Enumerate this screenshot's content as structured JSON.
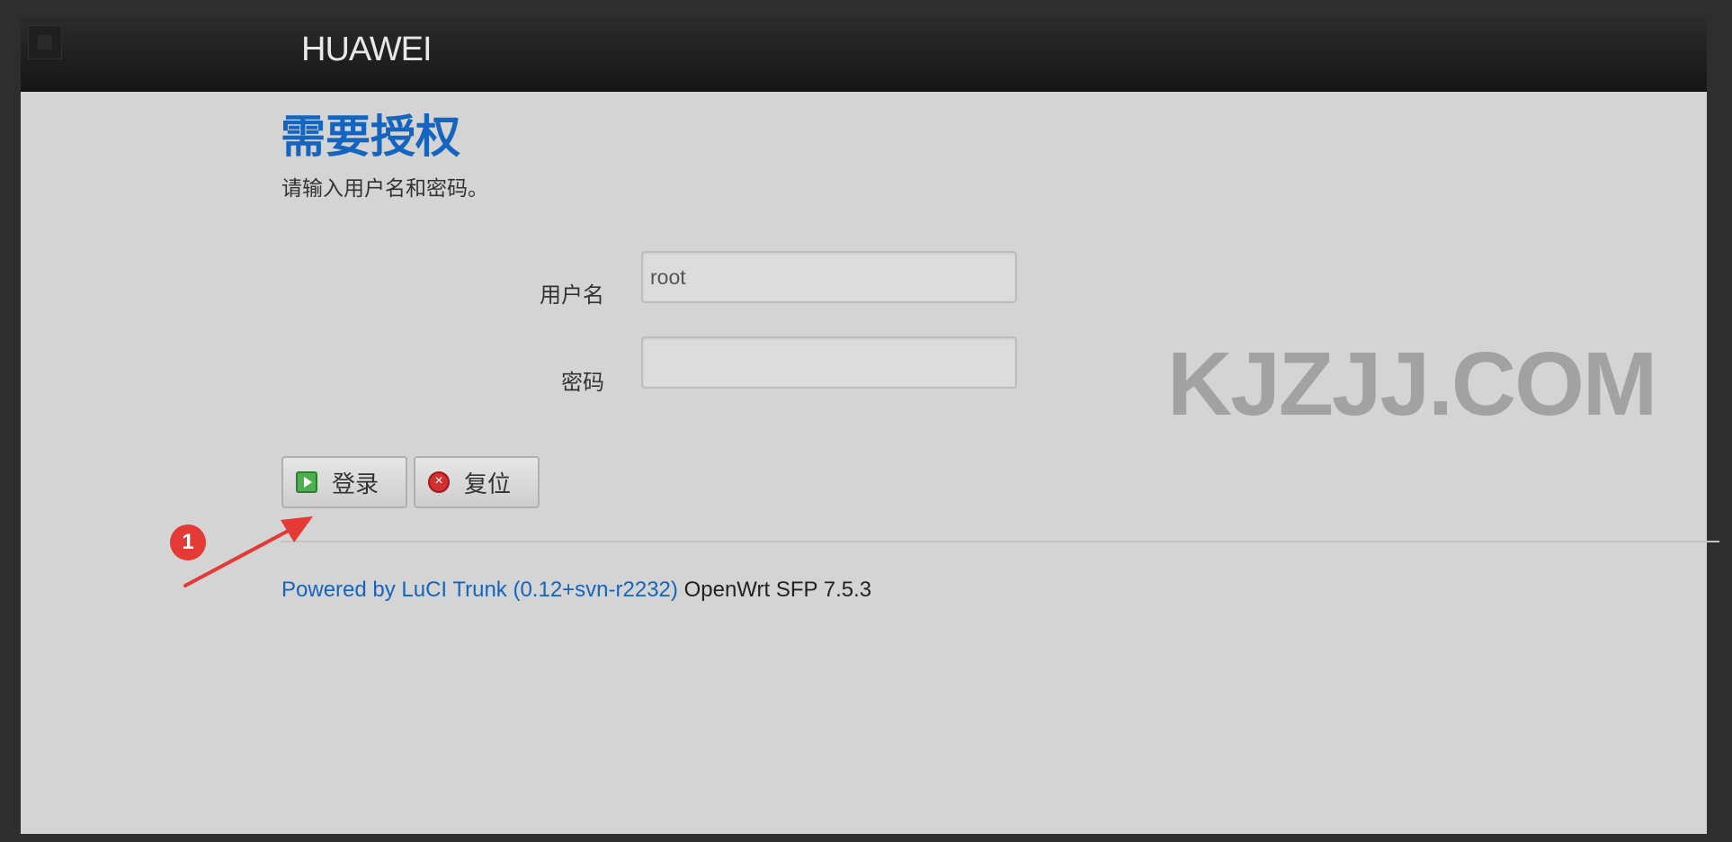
{
  "header": {
    "brand": "HUAWEI"
  },
  "auth": {
    "title": "需要授权",
    "description": "请输入用户名和密码。",
    "username_label": "用户名",
    "username_value": "root",
    "password_label": "密码",
    "password_value": ""
  },
  "buttons": {
    "login_label": "登录",
    "reset_label": "复位"
  },
  "footer": {
    "powered_link": "Powered by LuCI Trunk (0.12+svn-r2232)",
    "version": " OpenWrt SFP 7.5.3"
  },
  "watermark": "KJZJJ.COM",
  "annotation": {
    "step_number": "1"
  },
  "colors": {
    "accent_blue": "#1565c0",
    "annotation_red": "#e53935",
    "header_bg": "#1c1c1c",
    "page_bg": "#d4d4d4"
  }
}
